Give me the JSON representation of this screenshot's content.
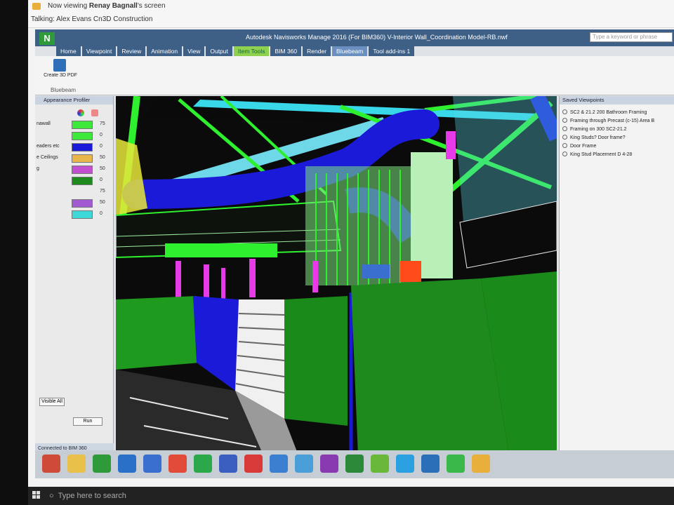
{
  "share": {
    "viewing_prefix": "Now viewing",
    "viewing_name": "Renay Bagnall",
    "viewing_suffix": "'s screen",
    "talking": "Talking: Alex Evans Cn3D Construction"
  },
  "app": {
    "title": "Autodesk Navisworks Manage 2016 (For BIM360)   V-Interior Wall_Coordination Model-RB.nwf",
    "search_placeholder": "Type a keyword or phrase",
    "tabs": [
      "Home",
      "Viewpoint",
      "Review",
      "Animation",
      "View",
      "Output",
      "Item Tools",
      "BIM 360",
      "Render",
      "Bluebeam",
      "Tool add-ins 1"
    ],
    "ribbon": {
      "create_3d_pdf": "Create 3D PDF",
      "group": "Bluebeam"
    }
  },
  "left_panel": {
    "title": "Appearance Profiler",
    "rows": [
      {
        "label": "nawall",
        "color": "#3ee83a",
        "value": "75"
      },
      {
        "label": "",
        "color": "#3ee83a",
        "value": "0"
      },
      {
        "label": "eaders etc",
        "color": "#1a1ad8",
        "value": "0"
      },
      {
        "label": "e Ceilings",
        "color": "#e8b64a",
        "value": "50"
      },
      {
        "label": "g",
        "color": "#c24ed0",
        "value": "50"
      },
      {
        "label": "",
        "color": "#1e8a1e",
        "value": "0"
      },
      {
        "label": "",
        "color": "",
        "value": "75"
      },
      {
        "label": "",
        "color": "#a25ad0",
        "value": "50"
      },
      {
        "label": "",
        "color": "#3ed8d8",
        "value": "0"
      }
    ],
    "visible_all": "Visible All",
    "run": "Run",
    "status": "Connected to BIM 360"
  },
  "right_panel": {
    "title": "Saved Viewpoints",
    "items": [
      "SC2 & 21.2 200 Bathroom Framing",
      "Framing through Precast (c-15) Area B",
      "Framing on 300 SC2-21.2",
      "King Studs? Door frame?",
      "Door Frame",
      "King Stud Placement D 4-28"
    ]
  },
  "taskbar": {
    "icons": [
      {
        "name": "chrome-task-icon",
        "color": "#d04a3a"
      },
      {
        "name": "folder-task-icon",
        "color": "#e8c04a"
      },
      {
        "name": "navisworks-task-icon",
        "color": "#2e9a3a"
      },
      {
        "name": "outlook-task-icon",
        "color": "#2a6fc8"
      },
      {
        "name": "m-app-task-icon",
        "color": "#3a6fd0"
      },
      {
        "name": "browser-task-icon",
        "color": "#e24a3a"
      },
      {
        "name": "navis-green-task-icon",
        "color": "#2aa84a"
      },
      {
        "name": "revit-task-icon",
        "color": "#3a5fc0"
      },
      {
        "name": "autocad-task-icon",
        "color": "#d83a3a"
      },
      {
        "name": "autodesk-task-icon",
        "color": "#3a7fd0"
      },
      {
        "name": "chrome2-task-icon",
        "color": "#4a9fd8"
      },
      {
        "name": "onenote-task-icon",
        "color": "#8a3ab0"
      },
      {
        "name": "excel-task-icon",
        "color": "#2a8a3a"
      },
      {
        "name": "bluebeam-task-icon",
        "color": "#6ab83a"
      },
      {
        "name": "skype-task-icon",
        "color": "#2aa0e0"
      },
      {
        "name": "sharepoint-task-icon",
        "color": "#2a6fb8"
      },
      {
        "name": "spotify-task-icon",
        "color": "#3ab84a"
      },
      {
        "name": "app-task-icon",
        "color": "#e8b03a"
      }
    ]
  },
  "windows": {
    "search_placeholder": "Type here to search"
  }
}
